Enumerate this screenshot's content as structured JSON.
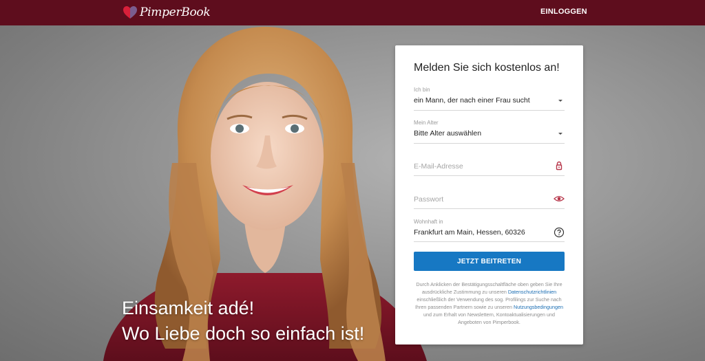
{
  "header": {
    "brand": "PimperBook",
    "login_label": "EINLOGGEN",
    "background_color": "#5e0d1d"
  },
  "hero": {
    "slogan_line1": "Einsamkeit adé!",
    "slogan_line2": "Wo Liebe doch so einfach ist!"
  },
  "signup": {
    "title": "Melden Sie sich kostenlos an!",
    "gender": {
      "label": "Ich bin",
      "value": "ein Mann, der nach einer Frau sucht"
    },
    "age": {
      "label": "Mein Alter",
      "value": "Bitte Alter auswählen"
    },
    "email": {
      "placeholder": "E-Mail-Adresse",
      "icon": "lock-icon"
    },
    "password": {
      "placeholder": "Passwort",
      "icon": "eye-icon"
    },
    "location": {
      "label": "Wohnhaft in",
      "value": "Frankfurt am Main, Hessen, 60326",
      "icon": "help-icon"
    },
    "submit_label": "JETZT BEITRETEN",
    "button_color": "#1778c3",
    "legal": {
      "part1": "Durch Anklicken der Bestätigungsschaltfläche oben geben Sie Ihre ausdrückliche Zustimmung zu unseren",
      "privacy_link": "Datenschutzrichtlinien",
      "part2": "einschließlich der Verwendung des sog. Profilings zur Suche nach Ihren passenden Partnern sowie zu unseren",
      "terms_link": "Nutzungsbedingungen",
      "part3": "und zum Erhalt von Newslettern, Kontoaktualisierungen und Angeboten von Pimperbook."
    }
  }
}
